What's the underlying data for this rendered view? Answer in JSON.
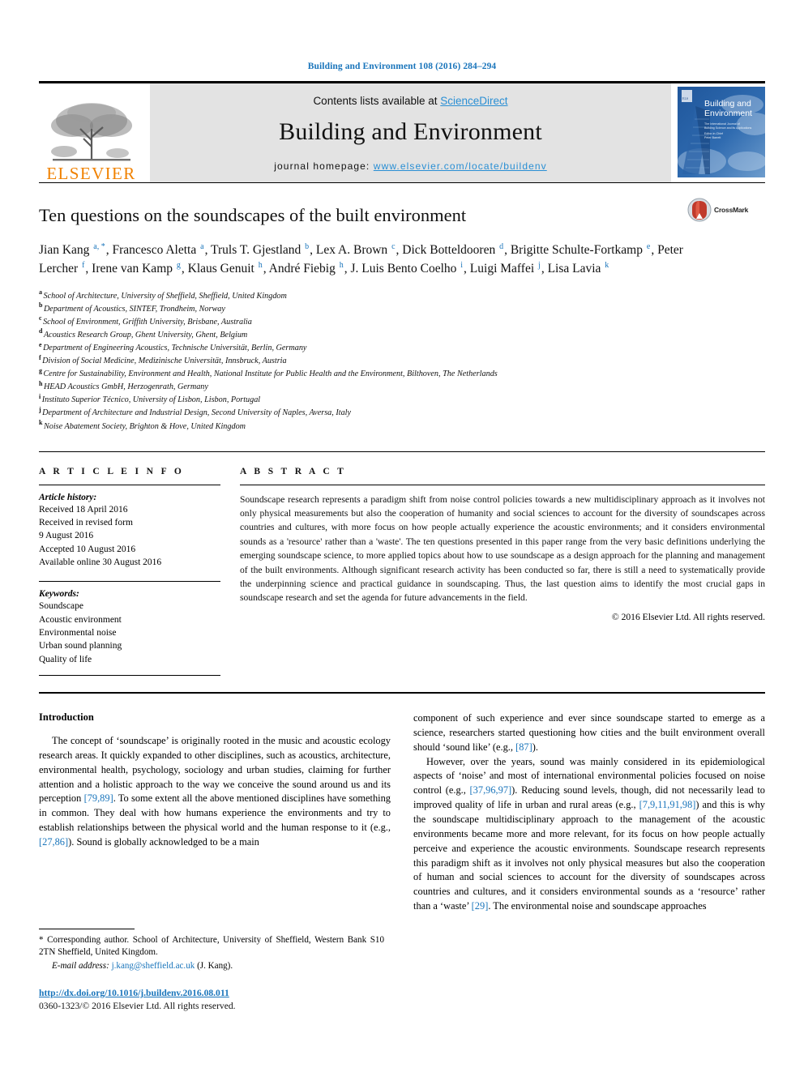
{
  "running_head": "Building and Environment 108 (2016) 284–294",
  "masthead": {
    "publisher_name": "ELSEVIER",
    "contents_prefix": "Contents lists available at ",
    "contents_link": "ScienceDirect",
    "journal_name": "Building and Environment",
    "homepage_prefix": "journal homepage: ",
    "homepage_url": "www.elsevier.com/locate/buildenv",
    "cover_title_line1": "Building and",
    "cover_title_line2": "Environment",
    "cover_sub_line1": "The International Journal of",
    "cover_sub_line2": "Building Science and its Applications",
    "cover_sub_line3": "Editor-in-Chief",
    "cover_sub_line4": "Peter Barrett"
  },
  "article": {
    "title": "Ten questions on the soundscapes of the built environment",
    "crossmark_label": "CrossMark",
    "authors": [
      {
        "name": "Jian Kang",
        "marks": "a, *",
        "sep": ", "
      },
      {
        "name": "Francesco Aletta",
        "marks": "a",
        "sep": ", "
      },
      {
        "name": "Truls T. Gjestland",
        "marks": "b",
        "sep": ", "
      },
      {
        "name": "Lex A. Brown",
        "marks": "c",
        "sep": ", "
      },
      {
        "name": "Dick Botteldooren",
        "marks": "d",
        "sep": ", "
      },
      {
        "name": "Brigitte Schulte-Fortkamp",
        "marks": "e",
        "sep": ", "
      },
      {
        "name": "Peter Lercher",
        "marks": "f",
        "sep": ", "
      },
      {
        "name": "Irene van Kamp",
        "marks": "g",
        "sep": ", "
      },
      {
        "name": "Klaus Genuit",
        "marks": "h",
        "sep": ", "
      },
      {
        "name": "André Fiebig",
        "marks": "h",
        "sep": ", "
      },
      {
        "name": "J. Luis Bento Coelho",
        "marks": "i",
        "sep": ", "
      },
      {
        "name": "Luigi Maffei",
        "marks": "j",
        "sep": ", "
      },
      {
        "name": "Lisa Lavia",
        "marks": "k",
        "sep": ""
      }
    ],
    "affiliations": [
      {
        "mark": "a",
        "text": "School of Architecture, University of Sheffield, Sheffield, United Kingdom"
      },
      {
        "mark": "b",
        "text": "Department of Acoustics, SINTEF, Trondheim, Norway"
      },
      {
        "mark": "c",
        "text": "School of Environment, Griffith University, Brisbane, Australia"
      },
      {
        "mark": "d",
        "text": "Acoustics Research Group, Ghent University, Ghent, Belgium"
      },
      {
        "mark": "e",
        "text": "Department of Engineering Acoustics, Technische Universität, Berlin, Germany"
      },
      {
        "mark": "f",
        "text": "Division of Social Medicine, Medizinische Universität, Innsbruck, Austria"
      },
      {
        "mark": "g",
        "text": "Centre for Sustainability, Environment and Health, National Institute for Public Health and the Environment, Bilthoven, The Netherlands"
      },
      {
        "mark": "h",
        "text": "HEAD Acoustics GmbH, Herzogenrath, Germany"
      },
      {
        "mark": "i",
        "text": "Instituto Superior Técnico, University of Lisbon, Lisbon, Portugal"
      },
      {
        "mark": "j",
        "text": "Department of Architecture and Industrial Design, Second University of Naples, Aversa, Italy"
      },
      {
        "mark": "k",
        "text": "Noise Abatement Society, Brighton & Hove, United Kingdom"
      }
    ]
  },
  "article_info": {
    "heading": "A R T I C L E   I N F O",
    "history_label": "Article history:",
    "history": [
      "Received 18 April 2016",
      "Received in revised form",
      "9 August 2016",
      "Accepted 10 August 2016",
      "Available online 30 August 2016"
    ],
    "keywords_label": "Keywords:",
    "keywords": [
      "Soundscape",
      "Acoustic environment",
      "Environmental noise",
      "Urban sound planning",
      "Quality of life"
    ]
  },
  "abstract": {
    "heading": "A B S T R A C T",
    "text": "Soundscape research represents a paradigm shift from noise control policies towards a new multidisciplinary approach as it involves not only physical measurements but also the cooperation of humanity and social sciences to account for the diversity of soundscapes across countries and cultures, with more focus on how people actually experience the acoustic environments; and it considers environmental sounds as a 'resource' rather than a 'waste'. The ten questions presented in this paper range from the very basic definitions underlying the emerging soundscape science, to more applied topics about how to use soundscape as a design approach for the planning and management of the built environments. Although significant research activity has been conducted so far, there is still a need to systematically provide the underpinning science and practical guidance in soundscaping. Thus, the last question aims to identify the most crucial gaps in soundscape research and set the agenda for future advancements in the field.",
    "copyright": "© 2016 Elsevier Ltd. All rights reserved."
  },
  "body": {
    "intro_heading": "Introduction",
    "left_para1_a": "The concept of ‘soundscape’ is originally rooted in the music and acoustic ecology research areas. It quickly expanded to other disciplines, such as acoustics, architecture, environmental health, psychology, sociology and urban studies, claiming for further attention and a holistic approach to the way we conceive the sound around us and its perception ",
    "left_ref1": "[79,89]",
    "left_para1_b": ". To some extent all the above mentioned disciplines have something in common. They deal with how humans experience the environments and try to establish relationships between the physical world and the human response to it (e.g., ",
    "left_ref2": "[27,86]",
    "left_para1_c": "). Sound is globally acknowledged to be a main",
    "right_para1_a": "component of such experience and ever since soundscape started to emerge as a science, researchers started questioning how cities and the built environment overall should ‘sound like’ (e.g., ",
    "right_ref1": "[87]",
    "right_para1_b": ").",
    "right_para2_a": "However, over the years, sound was mainly considered in its epidemiological aspects of ‘noise’ and most of international environmental policies focused on noise control (e.g., ",
    "right_ref2": "[37,96,97]",
    "right_para2_b": "). Reducing sound levels, though, did not necessarily lead to improved quality of life in urban and rural areas (e.g., ",
    "right_ref3": "[7,9,11,91,98]",
    "right_para2_c": ") and this is why the soundscape multidisciplinary approach to the management of the acoustic environments became more and more relevant, for its focus on how people actually perceive and experience the acoustic environments. Soundscape research represents this paradigm shift as it involves not only physical measures but also the cooperation of human and social sciences to account for the diversity of soundscapes across countries and cultures, and it considers environmental sounds as a ‘resource’ rather than a ‘waste’ ",
    "right_ref4": "[29]",
    "right_para2_d": ". The environmental noise and soundscape approaches"
  },
  "footnote": {
    "corresponding": "* Corresponding author. School of Architecture, University of Sheffield, Western Bank S10 2TN Sheffield, United Kingdom.",
    "email_label": "E-mail address:",
    "email": "j.kang@sheffield.ac.uk",
    "email_suffix": "(J. Kang).",
    "doi": "http://dx.doi.org/10.1016/j.buildenv.2016.08.011",
    "issn": "0360-1323/© 2016 Elsevier Ltd. All rights reserved."
  },
  "colors": {
    "link": "#1a75bb",
    "sciencedirect": "#2a8fd4",
    "elsevier_orange": "#f08100",
    "band_gray": "#e3e3e3",
    "cover_blue": "#1b4b8f"
  }
}
